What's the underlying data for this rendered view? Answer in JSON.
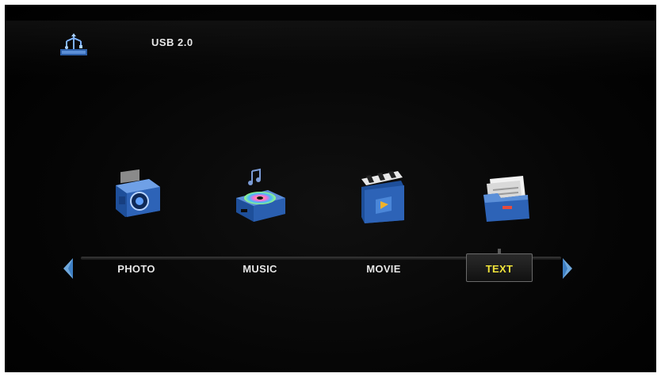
{
  "header": {
    "source_icon": "usb-drive-icon",
    "title": "USB 2.0"
  },
  "menu": {
    "items": [
      {
        "label": "PHOTO",
        "icon": "camera-icon",
        "selected": false
      },
      {
        "label": "MUSIC",
        "icon": "music-disc-icon",
        "selected": false
      },
      {
        "label": "MOVIE",
        "icon": "film-clapper-icon",
        "selected": false
      },
      {
        "label": "TEXT",
        "icon": "text-folder-icon",
        "selected": true
      }
    ],
    "nav": {
      "left_icon": "arrow-left-icon",
      "right_icon": "arrow-right-icon"
    }
  },
  "colors": {
    "background": "#000000",
    "label": "#e6e6e6",
    "selected_label": "#f0e33a",
    "arrow": "#6fa8dc",
    "icon_blue": "#2d63b7"
  }
}
